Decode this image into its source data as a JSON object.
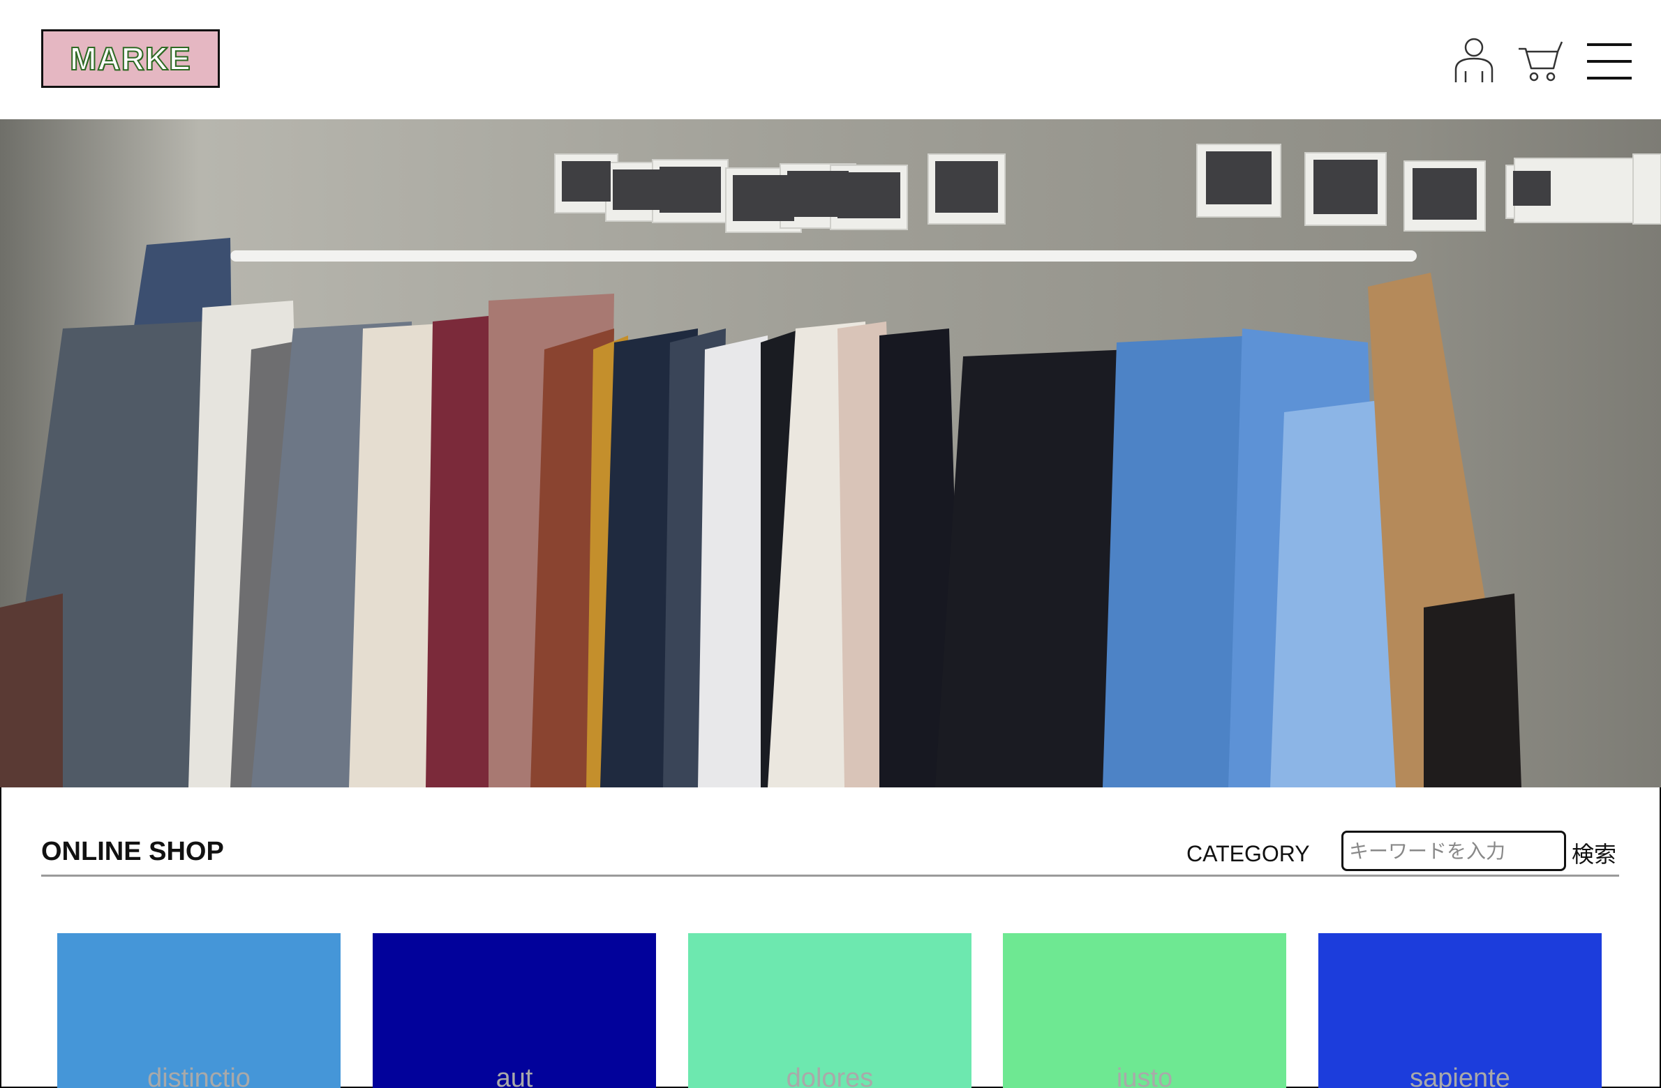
{
  "header": {
    "logo_text": "MARKE",
    "icons": [
      "user-icon",
      "cart-icon",
      "menu-icon"
    ]
  },
  "hero": {
    "image": "photo of clothes hanging on a rack in front of a concrete wall with polaroid photos"
  },
  "shop": {
    "title": "ONLINE SHOP",
    "category_label": "CATEGORY",
    "search_placeholder": "キーワードを入力",
    "search_button": "検索"
  },
  "products": [
    {
      "label": "distinctio",
      "color": "#4596d8"
    },
    {
      "label": "aut",
      "color": "#02029b"
    },
    {
      "label": "dolores",
      "color": "#6de8af"
    },
    {
      "label": "iusto",
      "color": "#6ee892"
    },
    {
      "label": "sapiente",
      "color": "#1c3ddc"
    }
  ],
  "colors": {
    "logo_bg": "#e5b7c2",
    "logo_text_outline": "#2f6a24",
    "divider": "#9a9a9a"
  }
}
